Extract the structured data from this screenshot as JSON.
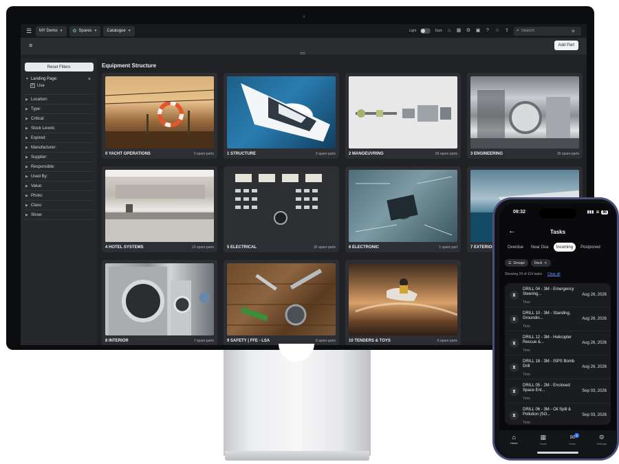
{
  "desktop": {
    "topbar": {
      "crumbs": [
        "MY Demo",
        "Spares",
        "Catalogue"
      ],
      "mode_light": "Light",
      "mode_dark": "Dark",
      "search_placeholder": "Search"
    },
    "toolbar": {
      "add_part": "Add Part"
    },
    "sidebar": {
      "reset_label": "Reset Filters",
      "landing_label": "Landing Page:",
      "landing_option": "Use",
      "filters": [
        "Location:",
        "Type:",
        "Critical:",
        "Stock Levels:",
        "Expired:",
        "Manufacturer:",
        "Supplier:",
        "Responsible:",
        "Used By:",
        "Value:",
        "Photo:",
        "Class:",
        "Show:"
      ]
    },
    "main": {
      "title": "Equipment Structure",
      "tiles": [
        {
          "name": "0 YACHT OPERATIONS",
          "count": "0 spare parts"
        },
        {
          "name": "1 STRUCTURE",
          "count": "2 spare parts"
        },
        {
          "name": "2 MANOEUVRING",
          "count": "55 spare parts"
        },
        {
          "name": "3 ENGINEERING",
          "count": "35 spare parts"
        },
        {
          "name": "4 HOTEL SYSTEMS",
          "count": "13 spare parts"
        },
        {
          "name": "5 ELECTRICAL",
          "count": "32 spare parts"
        },
        {
          "name": "6 ELECTRONIC",
          "count": "1 spare part"
        },
        {
          "name": "7 EXTERIOR",
          "count": ""
        },
        {
          "name": "8 INTERIOR",
          "count": "7 spare parts"
        },
        {
          "name": "9 SAFETY | FFE - LSA",
          "count": "9 spare parts"
        },
        {
          "name": "10 TENDERS & TOYS",
          "count": "6 spare parts"
        }
      ]
    }
  },
  "phone": {
    "time": "09:32",
    "battery": "86",
    "title": "Tasks",
    "tabs": [
      "Overdue",
      "Near Due",
      "Incoming",
      "Postponed"
    ],
    "active_tab": "Incoming",
    "chips": {
      "groups": "Groups",
      "deck": "Deck"
    },
    "showing": "Showing 24 of 114 tasks",
    "clear_all": "Clear all",
    "tasks": [
      {
        "name": "DRILL 04 - 3M - Emergency Steering...",
        "sub": "Time",
        "date": "Aug 26, 2026"
      },
      {
        "name": "DRILL 10 - 3M - Standing, Groundin...",
        "sub": "Time",
        "date": "Aug 26, 2026"
      },
      {
        "name": "DRILL 12 - 3M - Helicopter Rescue &...",
        "sub": "Time",
        "date": "Aug 26, 2026"
      },
      {
        "name": "DRILL 18 - 3M - ISPS Bomb Drill",
        "sub": "Time",
        "date": "Aug 26, 2026"
      },
      {
        "name": "DRILL 05 - 2M - Enclosed Space Ent...",
        "sub": "Time",
        "date": "Sep 03, 2026"
      },
      {
        "name": "DRILL 06 - 3M - Oil Spill & Pollution (SO...",
        "sub": "Time",
        "date": "Sep 03, 2026"
      }
    ],
    "nav": [
      {
        "label": "Home",
        "icon": "home-icon"
      },
      {
        "label": "Tasks",
        "icon": "grid-icon"
      },
      {
        "label": "Inbox",
        "icon": "inbox-icon",
        "badge": "1"
      },
      {
        "label": "Settings",
        "icon": "gear-icon"
      }
    ]
  }
}
